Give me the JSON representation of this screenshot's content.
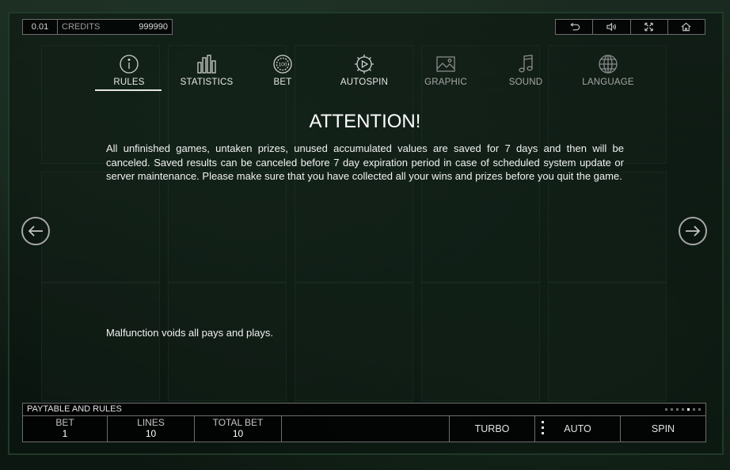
{
  "top_bar": {
    "denomination": "0.01",
    "credits_label": "CREDITS",
    "credits_value": "999990"
  },
  "top_icons": [
    "undo-icon",
    "sound-icon",
    "fullscreen-icon",
    "home-icon"
  ],
  "tabs": [
    {
      "label": "RULES",
      "icon": "info-icon",
      "active": true
    },
    {
      "label": "STATISTICS",
      "icon": "bar-chart-icon"
    },
    {
      "label": "BET",
      "icon": "chip-icon",
      "chip_text": "100"
    },
    {
      "label": "AUTOSPIN",
      "icon": "autospin-icon"
    },
    {
      "label": "GRAPHIC",
      "icon": "image-icon"
    },
    {
      "label": "SOUND",
      "icon": "music-note-icon"
    },
    {
      "label": "LANGUAGE",
      "icon": "globe-icon"
    }
  ],
  "content": {
    "title": "ATTENTION!",
    "paragraph": "All unfinished games, untaken prizes, unused accumulated values are saved for 7 days and then will be canceled. Saved results can be canceled before 7 day expiration period in case of scheduled system update or server maintenance. Please make sure that you have collected all your wins and prizes before you quit the game.",
    "malfunction": "Malfunction voids all pays and plays."
  },
  "paytable": {
    "label": "PAYTABLE AND RULES",
    "page_count": 7,
    "active_page": 5
  },
  "bottom": {
    "bet_label": "BET",
    "bet_value": "1",
    "lines_label": "LINES",
    "lines_value": "10",
    "total_bet_label": "TOTAL BET",
    "total_bet_value": "10",
    "turbo_label": "TURBO",
    "auto_label": "AUTO",
    "spin_label": "SPIN"
  }
}
